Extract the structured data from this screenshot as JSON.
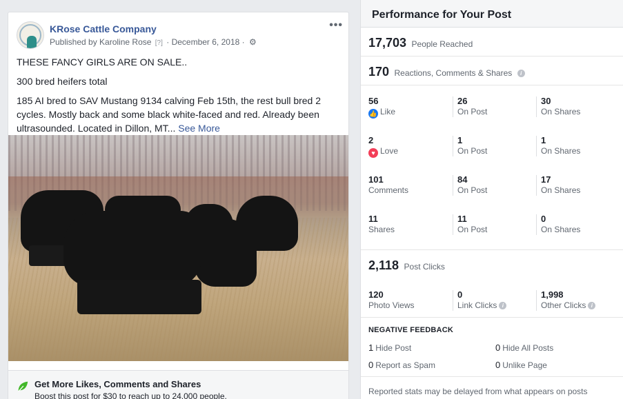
{
  "post": {
    "page_name": "KRose Cattle Company",
    "published_by": "Published by Karoline Rose",
    "help_marker": "[?]",
    "date": "· December 6, 2018 ·",
    "more_icon": "more-icon",
    "paragraphs": [
      "THESE FANCY GIRLS ARE ON SALE..",
      "300 bred heifers total",
      "185 AI bred to SAV Mustang 9134 calving Feb 15th, the rest bull bred 2 cycles. Mostly back and some black white-faced and red. Already been ultrasounded. Located in Dillon, MT..."
    ],
    "see_more": "See More",
    "boost_title": "Get More Likes, Comments and Shares",
    "boost_sub": "Boost this post for $30 to reach up to 24,000 people."
  },
  "performance": {
    "title": "Performance for Your Post",
    "reached": {
      "value": "17,703",
      "label": "People Reached"
    },
    "engagement": {
      "value": "170",
      "label": "Reactions, Comments & Shares"
    },
    "rows": [
      {
        "total": "56",
        "total_label": "Like",
        "post": "26",
        "post_label": "On Post",
        "shares": "30",
        "shares_label": "On Shares"
      },
      {
        "total": "2",
        "total_label": "Love",
        "post": "1",
        "post_label": "On Post",
        "shares": "1",
        "shares_label": "On Shares"
      },
      {
        "total": "101",
        "total_label": "Comments",
        "post": "84",
        "post_label": "On Post",
        "shares": "17",
        "shares_label": "On Shares"
      },
      {
        "total": "11",
        "total_label": "Shares",
        "post": "11",
        "post_label": "On Post",
        "shares": "0",
        "shares_label": "On Shares"
      }
    ],
    "clicks": {
      "value": "2,118",
      "label": "Post Clicks",
      "photo_views": "120",
      "photo_views_label": "Photo Views",
      "link_clicks": "0",
      "link_clicks_label": "Link Clicks",
      "other_clicks": "1,998",
      "other_clicks_label": "Other Clicks"
    },
    "negative": {
      "title": "NEGATIVE FEEDBACK",
      "hide_post": "1",
      "hide_post_label": "Hide Post",
      "hide_all": "0",
      "hide_all_label": "Hide All Posts",
      "spam": "0",
      "spam_label": "Report as Spam",
      "unlike": "0",
      "unlike_label": "Unlike Page"
    },
    "delay_note": "Reported stats may be delayed from what appears on posts"
  },
  "colors": {
    "link": "#385898",
    "like": "#1877f2",
    "love": "#f33e58",
    "boost_leaf": "#42b72a"
  }
}
